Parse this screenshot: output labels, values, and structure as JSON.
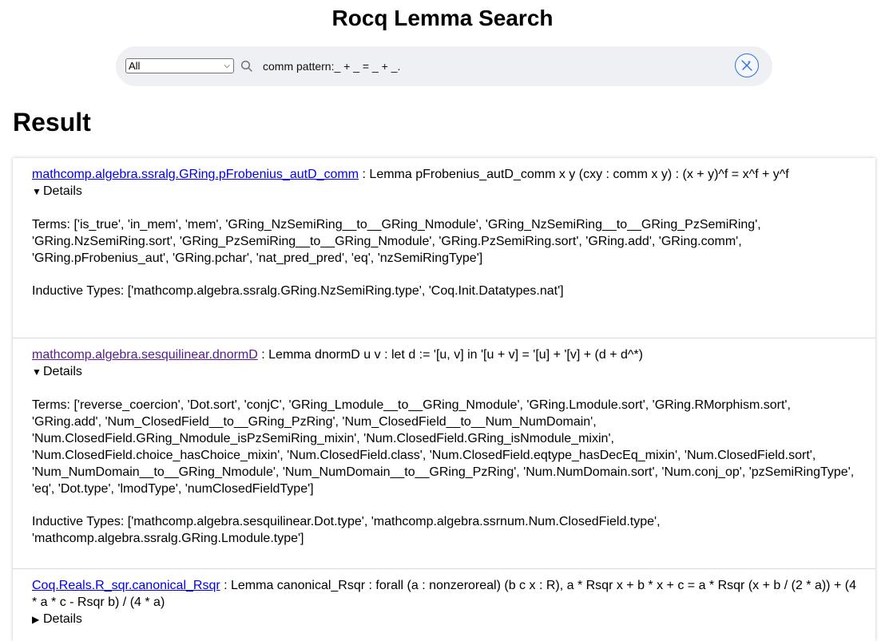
{
  "page": {
    "title": "Rocq Lemma Search"
  },
  "search": {
    "scope_selected": "All",
    "query": "comm pattern:_ + _ = _ + _."
  },
  "results_heading": "Result",
  "results": [
    {
      "name": "mathcomp.algebra.ssralg.GRing.pFrobenius_autD_comm",
      "statement": " : Lemma pFrobenius_autD_comm x y (cxy : comm x y) : (x + y)^f = x^f + y^f",
      "details_label": "Details",
      "details_open": true,
      "terms": "Terms: ['is_true', 'in_mem', 'mem', 'GRing_NzSemiRing__to__GRing_Nmodule', 'GRing_NzSemiRing__to__GRing_PzSemiRing', 'GRing.NzSemiRing.sort', 'GRing_PzSemiRing__to__GRing_Nmodule', 'GRing.PzSemiRing.sort', 'GRing.add', 'GRing.comm', 'GRing.pFrobenius_aut', 'GRing.pchar', 'nat_pred_pred', 'eq', 'nzSemiRingType']",
      "inductive_types": "Inductive Types: ['mathcomp.algebra.ssralg.GRing.NzSemiRing.type', 'Coq.Init.Datatypes.nat']"
    },
    {
      "name": "mathcomp.algebra.sesquilinear.dnormD",
      "statement": " : Lemma dnormD u v : let d := '[u, v] in '[u + v] = '[u] + '[v] + (d + d^*)",
      "details_label": "Details",
      "details_open": true,
      "terms": "Terms: ['reverse_coercion', 'Dot.sort', 'conjC', 'GRing_Lmodule__to__GRing_Nmodule', 'GRing.Lmodule.sort', 'GRing.RMorphism.sort', 'GRing.add', 'Num_ClosedField__to__GRing_PzRing', 'Num_ClosedField__to__Num_NumDomain', 'Num.ClosedField.GRing_Nmodule_isPzSemiRing_mixin', 'Num.ClosedField.GRing_isNmodule_mixin', 'Num.ClosedField.choice_hasChoice_mixin', 'Num.ClosedField.class', 'Num.ClosedField.eqtype_hasDecEq_mixin', 'Num.ClosedField.sort', 'Num_NumDomain__to__GRing_Nmodule', 'Num_NumDomain__to__GRing_PzRing', 'Num.NumDomain.sort', 'Num.conj_op', 'pzSemiRingType', 'eq', 'Dot.type', 'lmodType', 'numClosedFieldType']",
      "inductive_types": "Inductive Types: ['mathcomp.algebra.sesquilinear.Dot.type', 'mathcomp.algebra.ssrnum.Num.ClosedField.type', 'mathcomp.algebra.ssralg.GRing.Lmodule.type']"
    },
    {
      "name": "Coq.Reals.R_sqr.canonical_Rsqr",
      "statement": " : Lemma canonical_Rsqr : forall (a : nonzeroreal) (b c x : R), a * Rsqr x + b * x + c = a * Rsqr (x + b / (2 * a)) + (4 * a * c - Rsqr b) / (4 * a)",
      "details_label": "Details",
      "details_open": false
    }
  ],
  "colors": {
    "link": "#0000ee",
    "visited_link": "#551a8b",
    "accent": "#2f6fe0",
    "searchbar_bg": "#eef0f3"
  }
}
